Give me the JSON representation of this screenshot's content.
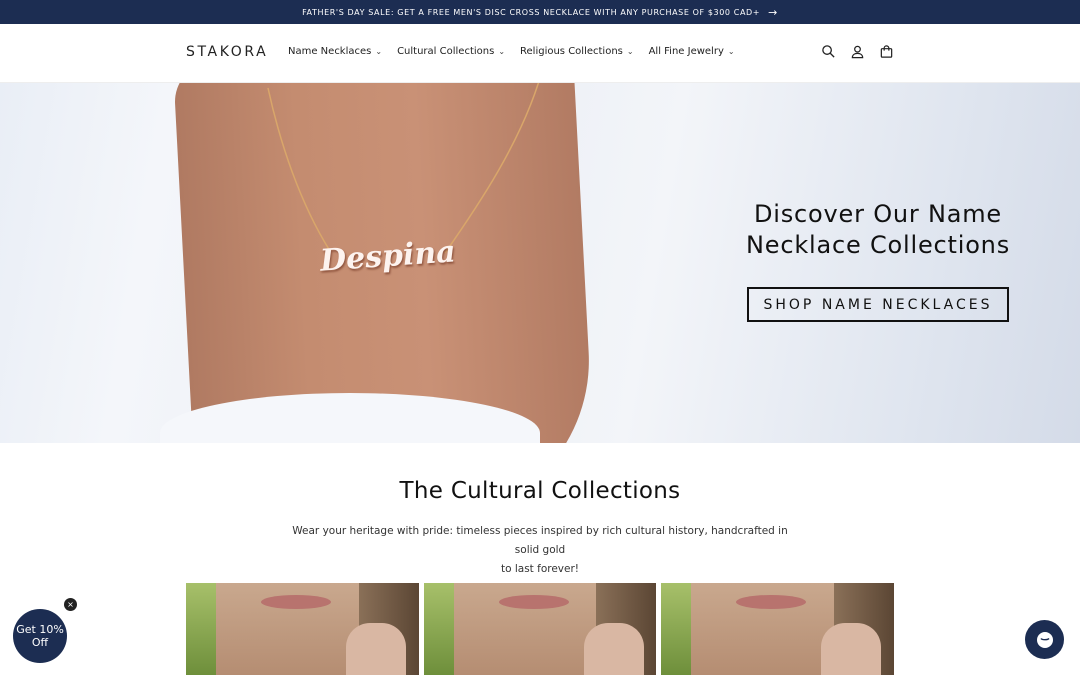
{
  "announcement": {
    "text": "FATHER'S DAY SALE: GET A FREE MEN'S DISC CROSS NECKLACE WITH ANY PURCHASE OF $300 CAD+",
    "arrow": "→"
  },
  "header": {
    "logo": "STAKORA",
    "nav": [
      {
        "label": "Name Necklaces"
      },
      {
        "label": "Cultural Collections"
      },
      {
        "label": "Religious Collections"
      },
      {
        "label": "All Fine Jewelry"
      }
    ],
    "icons": [
      "search-icon",
      "account-icon",
      "cart-icon"
    ]
  },
  "hero": {
    "title_line1": "Discover Our Name",
    "title_line2": "Necklace Collections",
    "button": "SHOP NAME NECKLACES",
    "pendant_text": "Despina"
  },
  "cultural": {
    "title": "The Cultural Collections",
    "desc_line1": "Wear your heritage with pride: timeless pieces inspired by rich cultural history, handcrafted in solid gold",
    "desc_line2": "to last forever!"
  },
  "promo": {
    "line1": "Get 10%",
    "line2": "Off",
    "close": "×"
  },
  "colors": {
    "navy": "#1c2d52"
  }
}
